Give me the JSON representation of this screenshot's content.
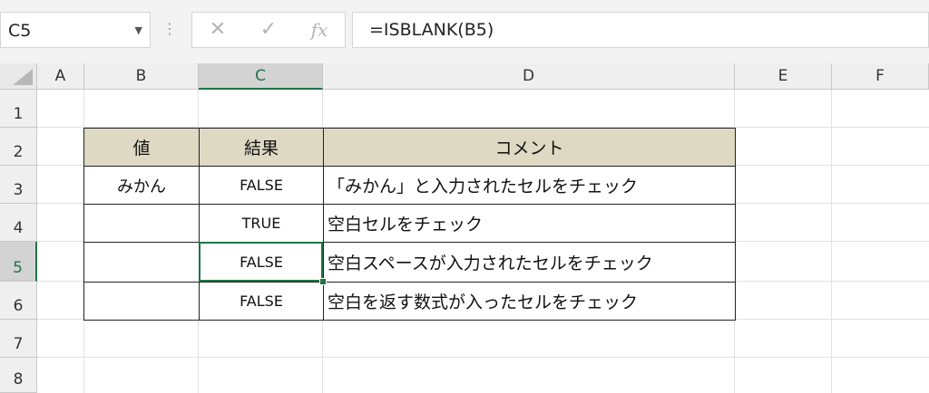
{
  "namebox": {
    "value": "C5",
    "dropdown_glyph": "▼"
  },
  "formula_bar": {
    "dots": "⋮",
    "cancel_glyph": "✕",
    "enter_glyph": "✓",
    "fx_glyph": "fx",
    "formula": "=ISBLANK(B5)"
  },
  "columns": [
    "A",
    "B",
    "C",
    "D",
    "E",
    "F"
  ],
  "rows": [
    "1",
    "2",
    "3",
    "4",
    "5",
    "6",
    "7",
    "8"
  ],
  "selected": {
    "column": "C",
    "row": "5"
  },
  "table": {
    "headers": [
      "値",
      "結果",
      "コメント"
    ],
    "rows": [
      {
        "value": "みかん",
        "result": "FALSE",
        "comment": "「みかん」と入力されたセルをチェック"
      },
      {
        "value": "",
        "result": "TRUE",
        "comment": "空白セルをチェック"
      },
      {
        "value": "",
        "result": "FALSE",
        "comment": "空白スペースが入力されたセルをチェック"
      },
      {
        "value": "",
        "result": "FALSE",
        "comment": "空白を返す数式が入ったセルをチェック"
      }
    ]
  },
  "colors": {
    "accent": "#217346",
    "header_fill": "#ddd9c3"
  }
}
